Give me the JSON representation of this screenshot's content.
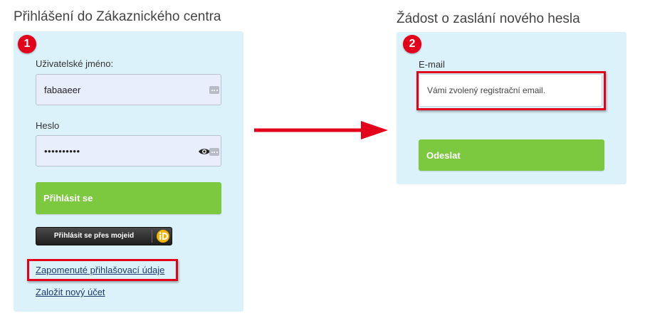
{
  "login": {
    "heading": "Přihlášení do Zákaznického centra",
    "step": "1",
    "username_label": "Uživatelské jméno:",
    "username_value": "fabaaeer",
    "password_label": "Heslo",
    "password_value": "••••••••••",
    "login_button": "Přihlásit se",
    "mojeid_button": "Přihlásit se přes mojeid",
    "forgot_link": "Zapomenuté přihlašovací údaje",
    "register_link": "Založit nový účet"
  },
  "reset": {
    "heading": "Žádost o zaslání nového hesla",
    "step": "2",
    "email_label": "E-mail",
    "email_placeholder": "Vámi zvolený registrační email.",
    "submit_button": "Odeslat"
  },
  "colors": {
    "panel_bg": "#dcf2fa",
    "accent_green": "#7cc83f",
    "highlight_red": "#e3001b"
  }
}
